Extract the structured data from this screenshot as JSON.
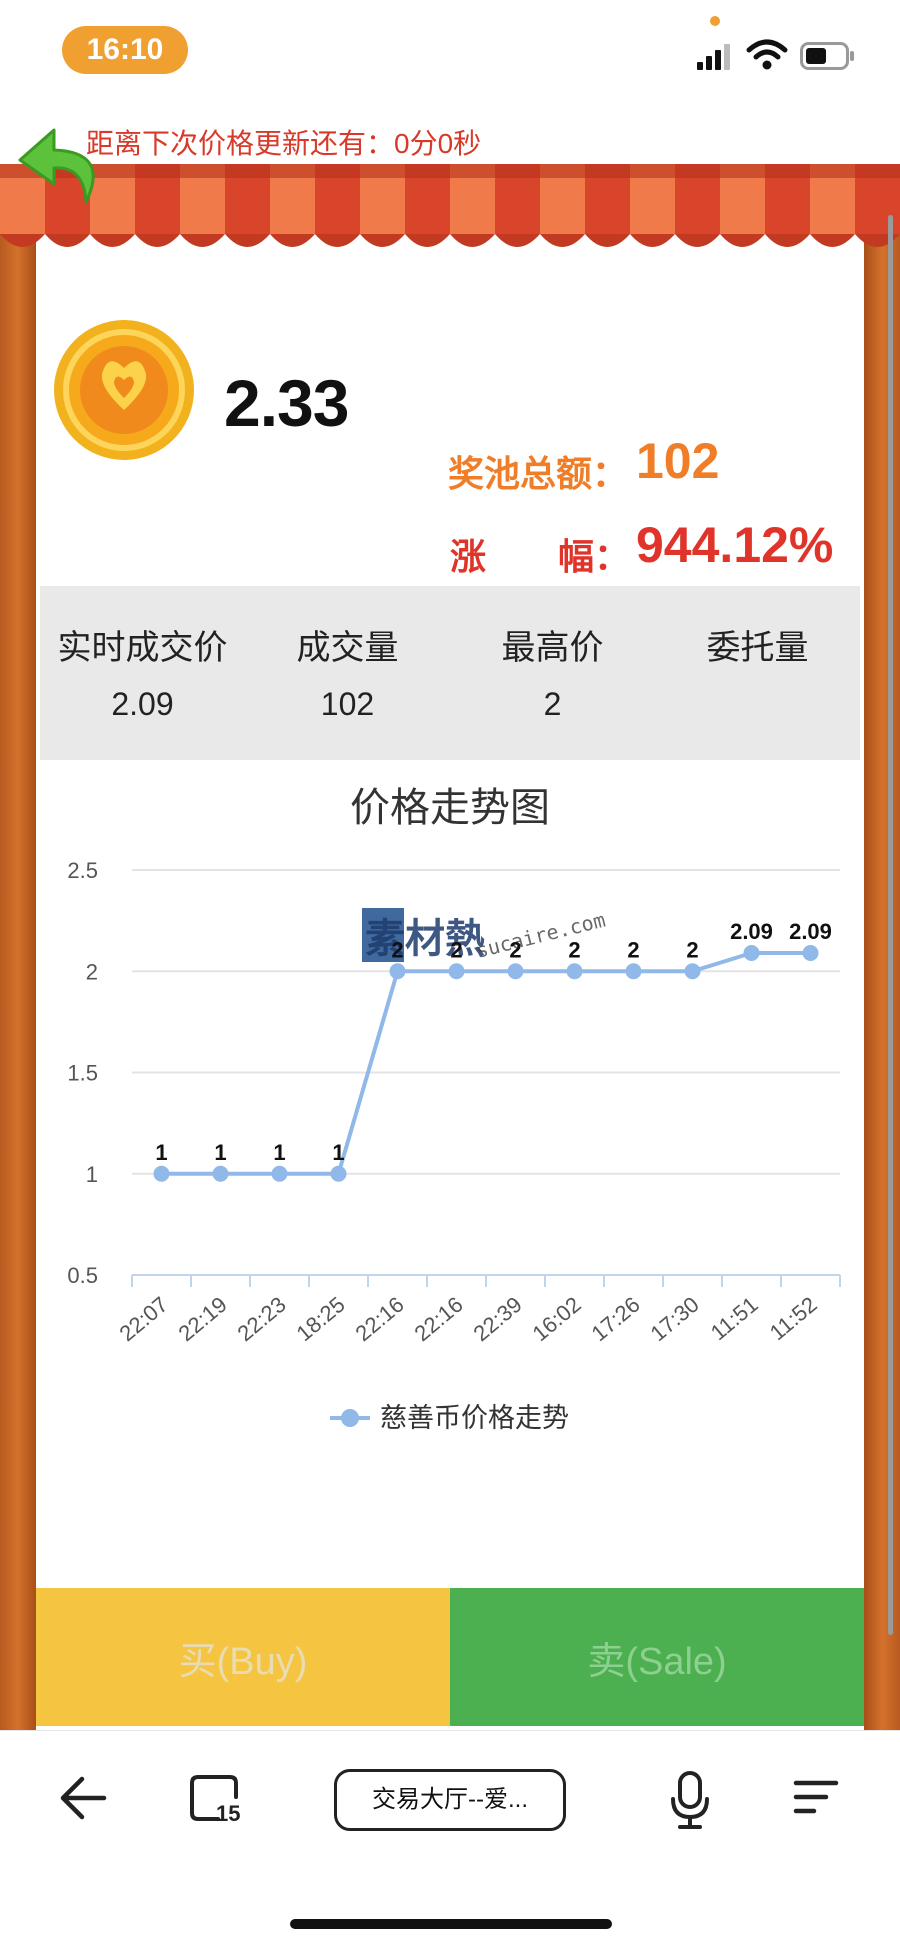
{
  "status_bar": {
    "time": "16:10"
  },
  "countdown": {
    "text": "距离下次价格更新还有：0分0秒"
  },
  "summary": {
    "current_price": "2.33",
    "pool_label": "奖池总额：",
    "pool_value": "102",
    "change_label": "涨　　幅：",
    "change_value": "944.12%"
  },
  "stats": [
    {
      "label": "实时成交价",
      "value": "2.09"
    },
    {
      "label": "成交量",
      "value": "102"
    },
    {
      "label": "最高价",
      "value": "2"
    },
    {
      "label": "委托量",
      "value": ""
    }
  ],
  "chart_data": {
    "type": "line",
    "title": "价格走势图",
    "categories": [
      "22:07",
      "22:19",
      "22:23",
      "18:25",
      "22:16",
      "22:16",
      "22:39",
      "16:02",
      "17:26",
      "17:30",
      "11:51",
      "11:52"
    ],
    "series": [
      {
        "name": "慈善币价格走势",
        "values": [
          1,
          1,
          1,
          1,
          2,
          2,
          2,
          2,
          2,
          2,
          2.09,
          2.09
        ]
      }
    ],
    "data_labels": [
      "1",
      "1",
      "1",
      "1",
      "2",
      "2",
      "2",
      "2",
      "2",
      "2",
      "2.09",
      "2.09"
    ],
    "y_ticks": [
      "0.5",
      "1",
      "1.5",
      "2",
      "2.5"
    ],
    "ylim": [
      0.5,
      2.5
    ],
    "grid": true,
    "legend": "bottom-center",
    "color": "#90b8e8",
    "watermark": "素材熱 sucaire.com"
  },
  "actions": {
    "buy_label": "买(Buy)",
    "sale_label": "卖(Sale)"
  },
  "browser": {
    "url_text": "交易大厅--爱..."
  },
  "colors": {
    "accent_orange": "#f07d28",
    "accent_red": "#e0342a",
    "buy": "#f5c542",
    "sale": "#4caf50"
  }
}
